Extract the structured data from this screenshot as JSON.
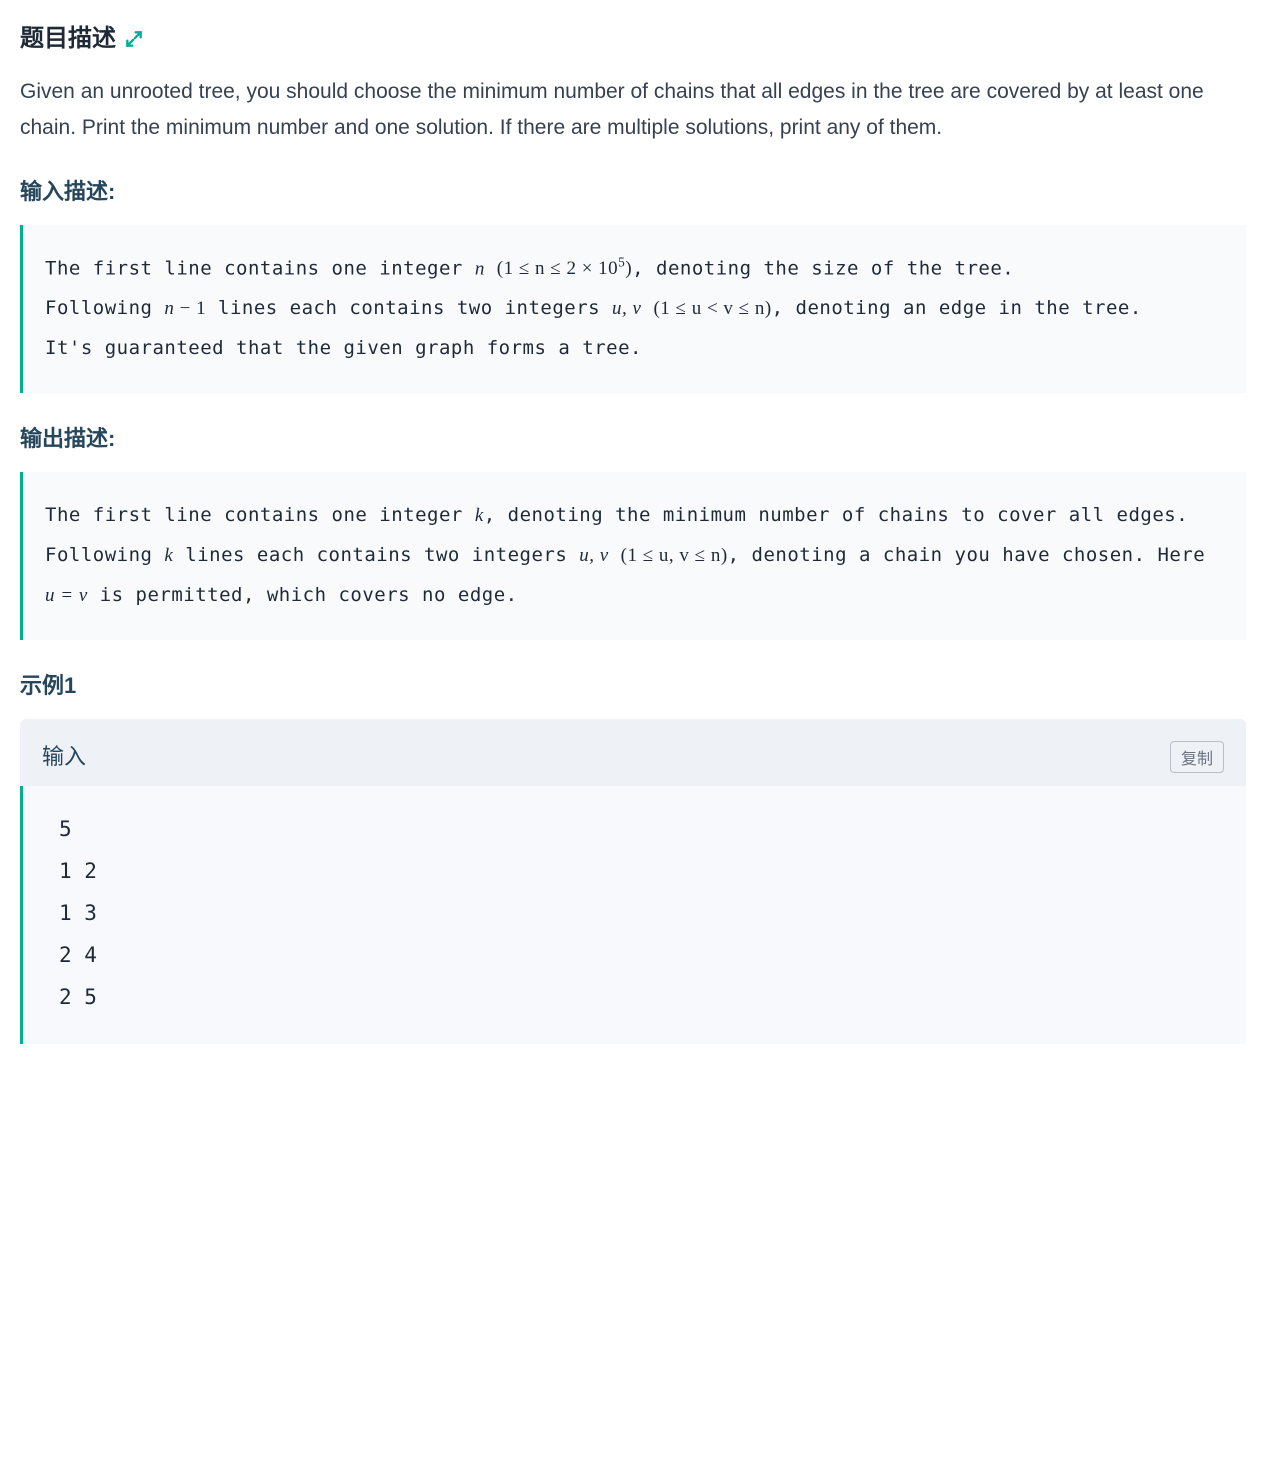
{
  "sections": {
    "problem_title": "题目描述",
    "input_title": "输入描述:",
    "output_title": "输出描述:",
    "example_title": "示例1",
    "example_input_label": "输入",
    "copy_label": "复制"
  },
  "problem_text": "Given an unrooted tree, you should choose the minimum number of chains that all edges in the tree are covered by at least one chain. Print the minimum number and one solution. If there are multiple solutions, print any of them.",
  "input_desc": {
    "line1_a": "The first line contains one integer ",
    "line1_b": ", denoting the size of the tree.",
    "line2_a": "Following ",
    "line2_b": " lines each contains two integers ",
    "line2_c": ", denoting an edge in the tree.",
    "line3": "It's guaranteed that the given graph forms a tree.",
    "math_n": "n",
    "math_n_range": "(1 ≤ n ≤ 2 × 10",
    "math_n_exp": "5",
    "math_n_close": ")",
    "math_nm1_a": "n",
    "math_nm1_b": " − 1",
    "math_uv": "u, v",
    "math_uv_range": "(1 ≤ u < v ≤ n)"
  },
  "output_desc": {
    "line1_a": "The first line contains one integer ",
    "line1_b": ", denoting the minimum number of chains to cover all edges.",
    "line2_a": "Following ",
    "line2_b": " lines each contains two integers ",
    "line2_c": ", denoting a chain you have chosen. Here ",
    "line2_d": " is permitted, which covers no edge.",
    "math_k": "k",
    "math_uv": "u, v",
    "math_uv_range": "(1 ≤ u, v ≤ n)",
    "math_ueqv": "u = v"
  },
  "example_input": "5\n1 2\n1 3\n2 4\n2 5"
}
